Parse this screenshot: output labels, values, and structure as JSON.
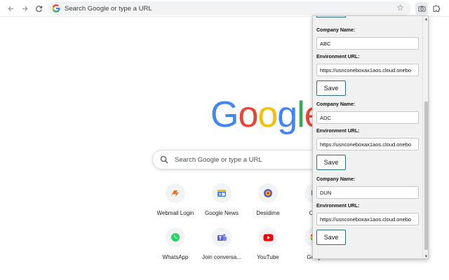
{
  "browser": {
    "omnibox_placeholder": "Search Google or type a URL"
  },
  "ntp": {
    "logo_letters": [
      "G",
      "o",
      "o",
      "g",
      "l",
      "e"
    ],
    "logo_colors": [
      "#4285f4",
      "#ea4335",
      "#fbbc05",
      "#4285f4",
      "#34a853",
      "#ea4335"
    ],
    "search_placeholder": "Search Google or type a URL",
    "shortcuts": [
      {
        "label": "Webmail Login",
        "icon": "webmail-logo-icon",
        "color": "#f26b21"
      },
      {
        "label": "Google News",
        "icon": "google-news-icon",
        "color": "#4285f4"
      },
      {
        "label": "Desidime",
        "icon": "desidime-icon",
        "color": "#d93025"
      },
      {
        "label": "Cha",
        "icon": "chat-icon",
        "color": "#5f6368"
      },
      {
        "label": "WhatsApp",
        "icon": "whatsapp-icon",
        "color": "#25d366"
      },
      {
        "label": "Join conversa...",
        "icon": "teams-icon",
        "color": "#5b5fc7"
      },
      {
        "label": "YouTube",
        "icon": "youtube-icon",
        "color": "#ff0000"
      },
      {
        "label": "Googl",
        "icon": "google-icon",
        "color": "#ea4335"
      }
    ]
  },
  "popup": {
    "companies": [
      {
        "company_label": "Company Name:",
        "company_value": "ABC",
        "env_label": "Environment URL:",
        "env_value": "https://usnconeboxax1aos.cloud.onebo",
        "save_label": "Save"
      },
      {
        "company_label": "Company Name:",
        "company_value": "ADC",
        "env_label": "Environment URL:",
        "env_value": "https://usnconeboxax1aos.cloud.onebo",
        "save_label": "Save"
      },
      {
        "company_label": "Company Name:",
        "company_value": "DUN",
        "env_label": "Environment URL:",
        "env_value": "https://usnconeboxax1aos.cloud.onebo",
        "save_label": "Save"
      }
    ],
    "scroll_position": 0.62
  },
  "colors": {
    "accent_border": "#2c6e86"
  }
}
